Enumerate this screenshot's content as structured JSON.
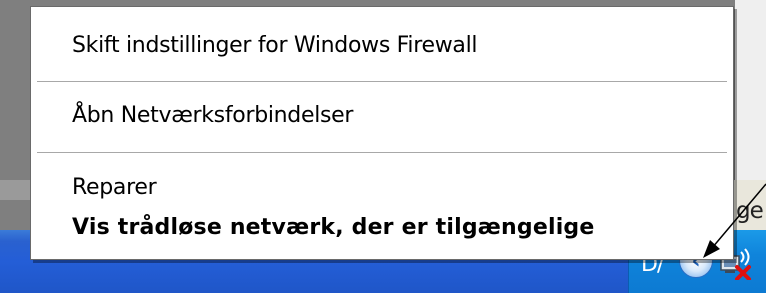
{
  "context_menu": {
    "items": [
      {
        "label": "Skift indstillinger for Windows Firewall"
      },
      {
        "label": "Åbn Netværksforbindelser"
      },
      {
        "label": "Reparer"
      },
      {
        "label": "Vis trådløse netværk, der er tilgængelige",
        "default": true
      }
    ]
  },
  "window_fragment": {
    "text": "ge"
  },
  "tray": {
    "text": "D/",
    "chevron_icon": "chevron-left-icon",
    "network_icon": "wireless-network-disconnected-icon"
  },
  "colors": {
    "taskbar": "#245ed7",
    "tray": "#0f84db",
    "menu_bg": "#ffffff",
    "error_x": "#e01010"
  }
}
